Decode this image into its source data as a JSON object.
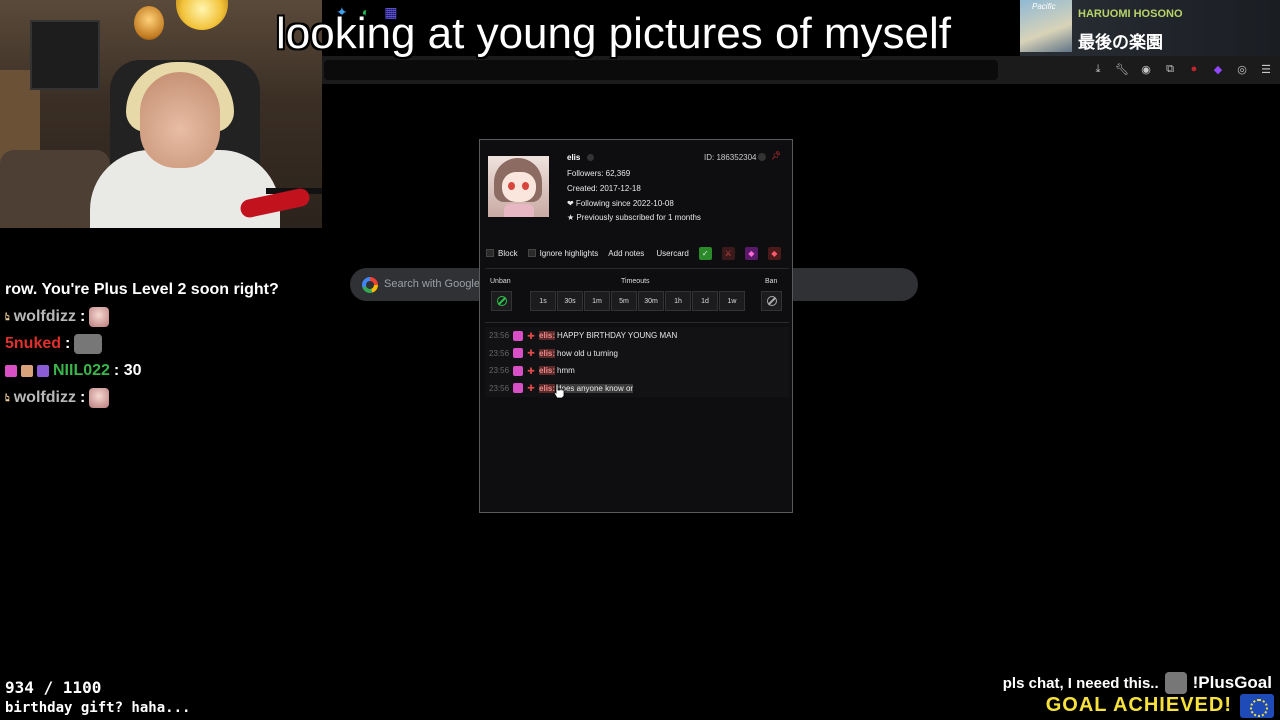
{
  "caption": "looking at young pictures of myself",
  "now_playing": {
    "cover_text": "Pacific",
    "artist": "HARUOMI HOSONO",
    "track": "最後の楽園"
  },
  "search": {
    "placeholder": "Search with Google or"
  },
  "chat": [
    {
      "user": "",
      "text": "row. You're Plus Level 2 soon right?",
      "user_color": "#ffffff"
    },
    {
      "user": "wolfdizz",
      "text": ":",
      "user_color": "#b8b8b8"
    },
    {
      "user": "5nuked",
      "text": ":",
      "user_color": "#e0302c"
    },
    {
      "user": "NIIL022",
      "text": ": 30",
      "user_color": "#3ab54a"
    },
    {
      "user": "wolfdizz",
      "text": ":",
      "user_color": "#b8b8b8"
    }
  ],
  "goal": {
    "count": "934 / 1100",
    "text": "birthday gift? haha...",
    "plea": "pls chat, I neeed this..",
    "command": "!PlusGoal",
    "achieved": "GOAL ACHIEVED!"
  },
  "usercard": {
    "name": "elis",
    "id_label": "ID: 186352304",
    "followers": "Followers: 62,369",
    "created": "Created: 2017-12-18",
    "following": "❤ Following since 2022-10-08",
    "subscribed": "★ Previously subscribed for 1 months",
    "options": {
      "block": "Block",
      "ignore_highlights": "Ignore highlights",
      "add_notes": "Add notes",
      "usercard": "Usercard"
    },
    "mod": {
      "unban": "Unban",
      "timeouts": "Timeouts",
      "ban": "Ban",
      "durations": [
        "1s",
        "30s",
        "1m",
        "5m",
        "30m",
        "1h",
        "1d",
        "1w"
      ]
    },
    "messages": [
      {
        "time": "23:56",
        "user": "elis:",
        "text": "HAPPY BIRTHDAY YOUNG MAN"
      },
      {
        "time": "23:56",
        "user": "elis:",
        "text": "how old u turning"
      },
      {
        "time": "23:56",
        "user": "elis:",
        "text": "hmm"
      },
      {
        "time": "23:56",
        "user": "elis:",
        "text": "does anyone know or"
      }
    ]
  }
}
